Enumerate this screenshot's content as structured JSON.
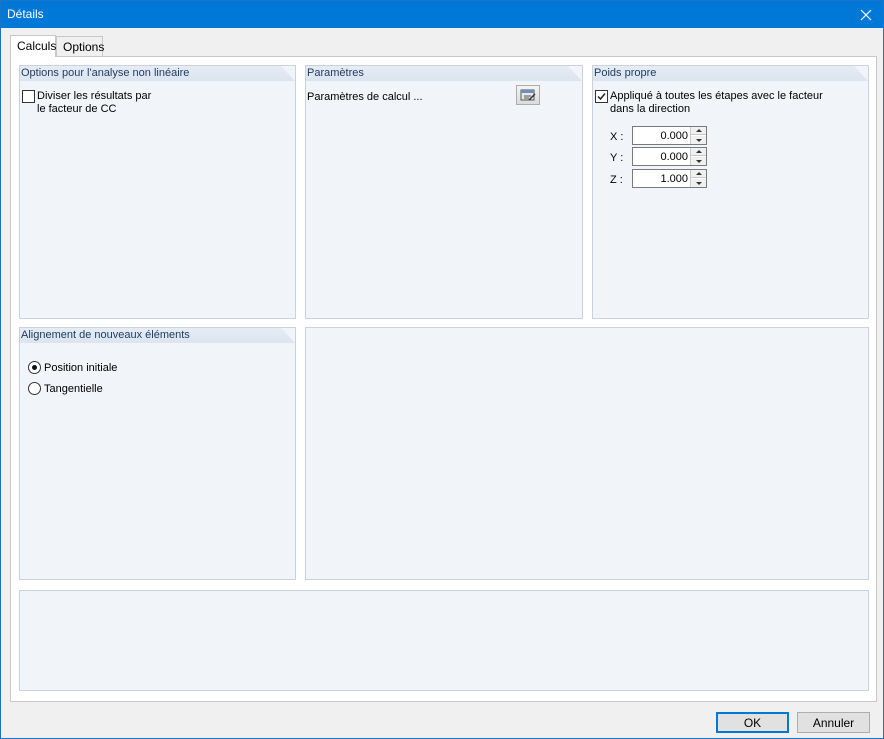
{
  "window": {
    "title": "Détails"
  },
  "tabs": [
    {
      "label": "Calculs",
      "active": true
    },
    {
      "label": "Options",
      "active": false
    }
  ],
  "nonlinear": {
    "title": "Options pour l'analyse non linéaire",
    "checkbox_line1": "Diviser les résultats par",
    "checkbox_line2": "le facteur de CC",
    "checked": false
  },
  "parameters": {
    "title": "Paramètres",
    "label": "Paramètres de calcul ...",
    "button_icon": "edit-parameters-icon"
  },
  "selfweight": {
    "title": "Poids propre",
    "checkbox_line1": "Appliqué à toutes les étapes avec le facteur",
    "checkbox_line2": "dans la direction",
    "checked": true,
    "x_label": "X :",
    "x_value": "0.000",
    "y_label": "Y :",
    "y_value": "0.000",
    "z_label": "Z :",
    "z_value": "1.000"
  },
  "alignment": {
    "title": "Alignement de nouveaux éléments",
    "option1": "Position initiale",
    "option2": "Tangentielle",
    "selected": "Position initiale"
  },
  "footer": {
    "ok_label": "OK",
    "cancel_label": "Annuler"
  },
  "colors": {
    "titlebar": "#0078d7",
    "group_bg": "#f1f4f8",
    "group_header_text": "#1d3a5e"
  }
}
